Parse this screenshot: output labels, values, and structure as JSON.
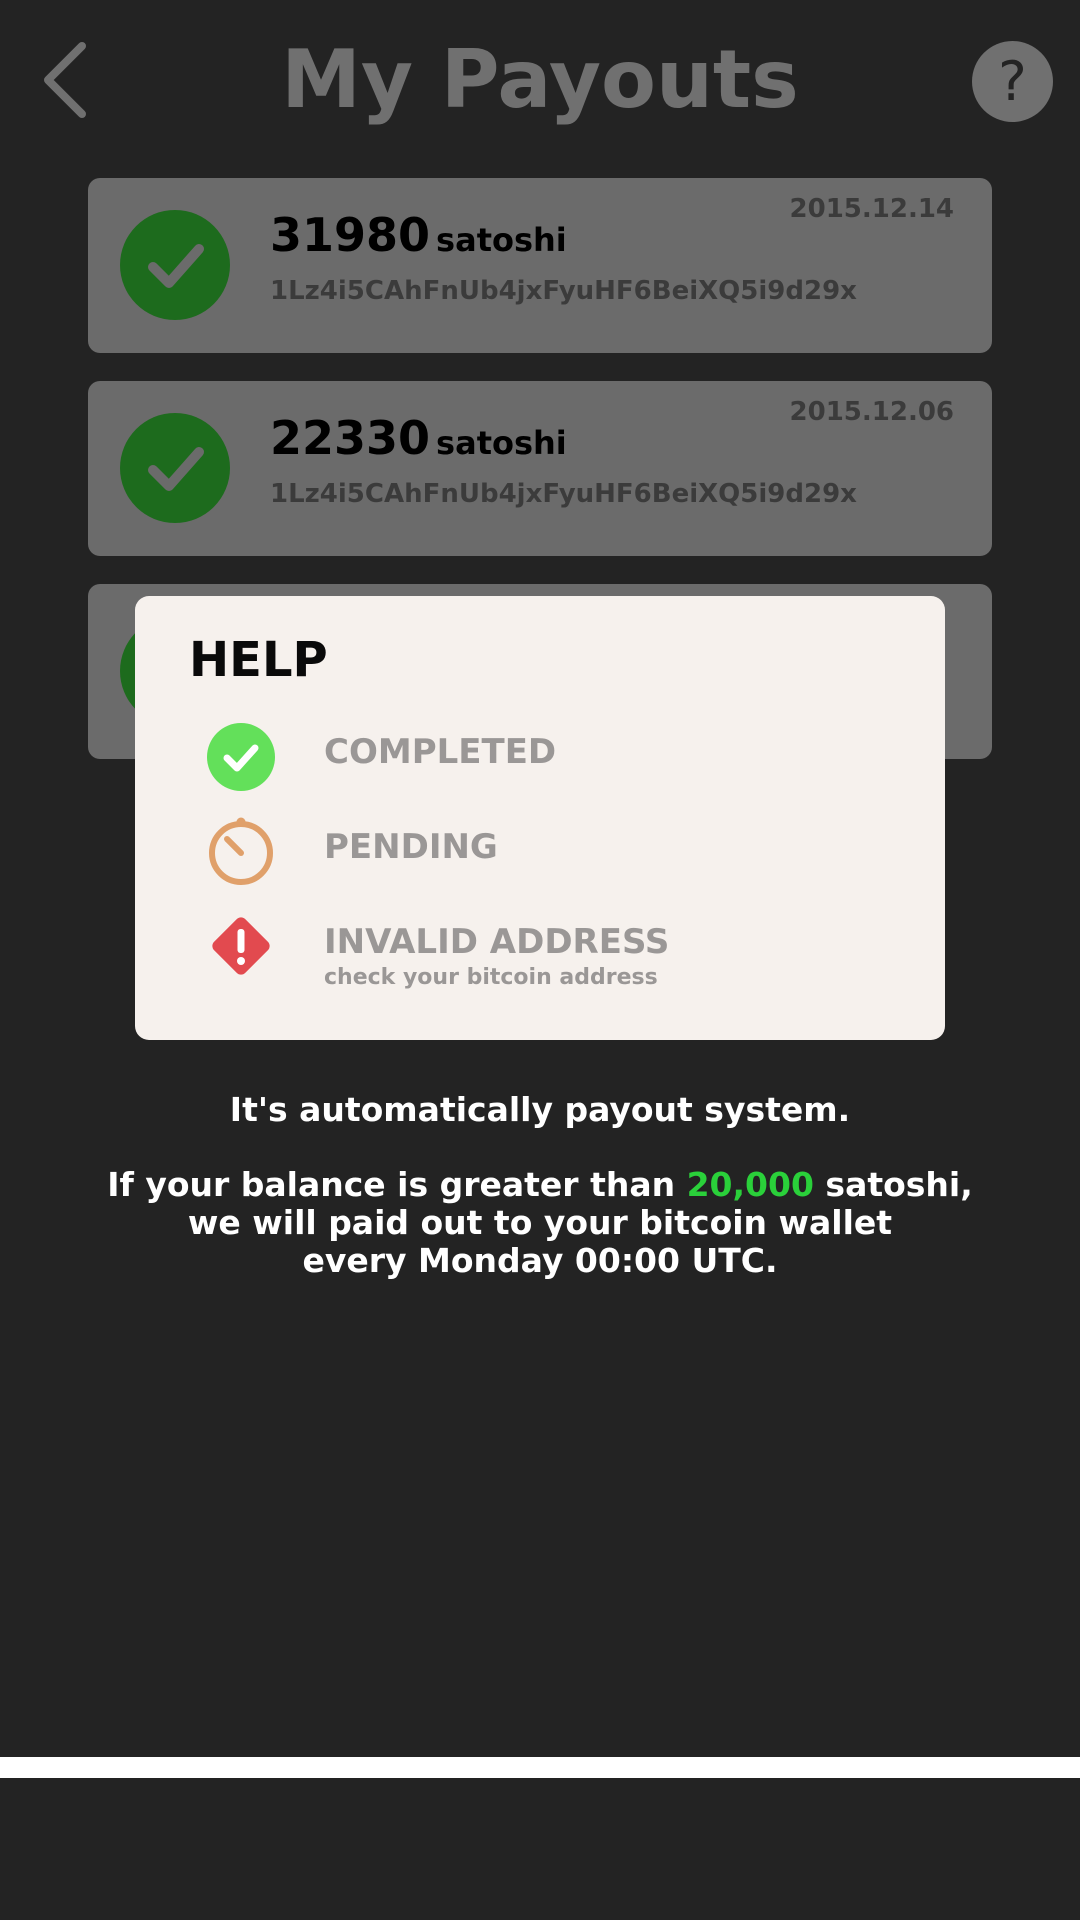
{
  "header": {
    "title": "My Payouts",
    "help_symbol": "?"
  },
  "payouts": [
    {
      "amount": "31980",
      "unit": "satoshi",
      "address": "1Lz4i5CAhFnUb4jxFyuHF6BeiXQ5i9d29x",
      "date": "2015.12.14",
      "status": "completed"
    },
    {
      "amount": "22330",
      "unit": "satoshi",
      "address": "1Lz4i5CAhFnUb4jxFyuHF6BeiXQ5i9d29x",
      "date": "2015.12.06",
      "status": "completed"
    },
    {
      "amount": "",
      "unit": "",
      "address": "",
      "date": "",
      "status": "completed"
    }
  ],
  "help": {
    "title": "HELP",
    "legend": [
      {
        "label": "COMPLETED",
        "icon": "check-circle-icon",
        "color": "#63e05a"
      },
      {
        "label": "PENDING",
        "icon": "stopwatch-icon",
        "color": "#e0a06a"
      },
      {
        "label": "INVALID ADDRESS",
        "sublabel": "check your bitcoin address",
        "icon": "warning-diamond-icon",
        "color": "#e24a4f"
      }
    ]
  },
  "info": {
    "line1": "It's automatically payout system.",
    "line2_prefix": "If your balance is greater than ",
    "line2_highlight": "20,000",
    "line2_suffix": " satoshi,",
    "line3": "we will paid out to your bitcoin wallet",
    "line4": "every Monday 00:00 UTC."
  },
  "colors": {
    "background": "#232323",
    "card": "#6b6b6b",
    "completed_dim": "#1d6b1d",
    "highlight": "#2ad03a",
    "modal": "#f6f1ed"
  }
}
